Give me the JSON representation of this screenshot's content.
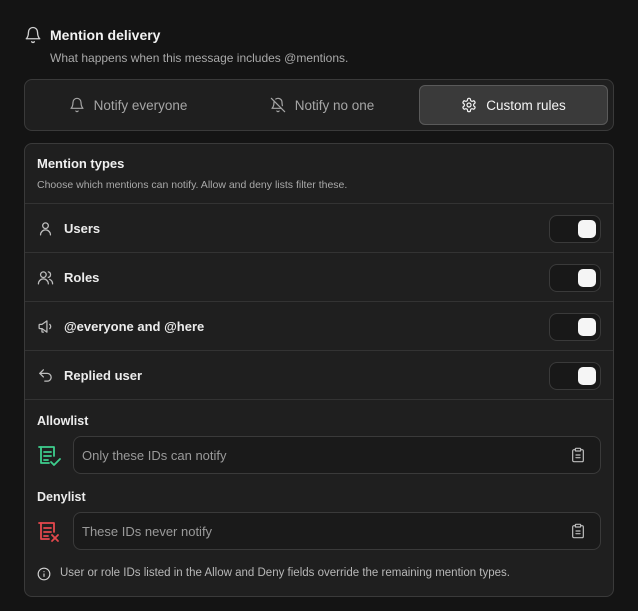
{
  "header": {
    "title": "Mention delivery",
    "subtitle": "What happens when this message includes @mentions."
  },
  "modes": [
    {
      "label": "Notify everyone",
      "icon": "bell-icon",
      "active": false
    },
    {
      "label": "Notify no one",
      "icon": "bell-off-icon",
      "active": false
    },
    {
      "label": "Custom rules",
      "icon": "gear-icon",
      "active": true
    }
  ],
  "panel": {
    "title": "Mention types",
    "subtitle": "Choose which mentions can notify. Allow and deny lists filter these.",
    "types": [
      {
        "label": "Users",
        "icon": "user-icon",
        "enabled": true
      },
      {
        "label": "Roles",
        "icon": "users-icon",
        "enabled": true
      },
      {
        "label": "@everyone and @here",
        "icon": "megaphone-icon",
        "enabled": true
      },
      {
        "label": "Replied user",
        "icon": "reply-icon",
        "enabled": true
      }
    ],
    "allowlist": {
      "label": "Allowlist",
      "placeholder": "Only these IDs can notify",
      "value": "",
      "icon": "list-check-icon",
      "color": "#3ecf8e"
    },
    "denylist": {
      "label": "Denylist",
      "placeholder": "These IDs never notify",
      "value": "",
      "icon": "list-x-icon",
      "color": "#e5484d"
    },
    "note": "User or role IDs listed in the Allow and Deny fields override the remaining mention types."
  }
}
